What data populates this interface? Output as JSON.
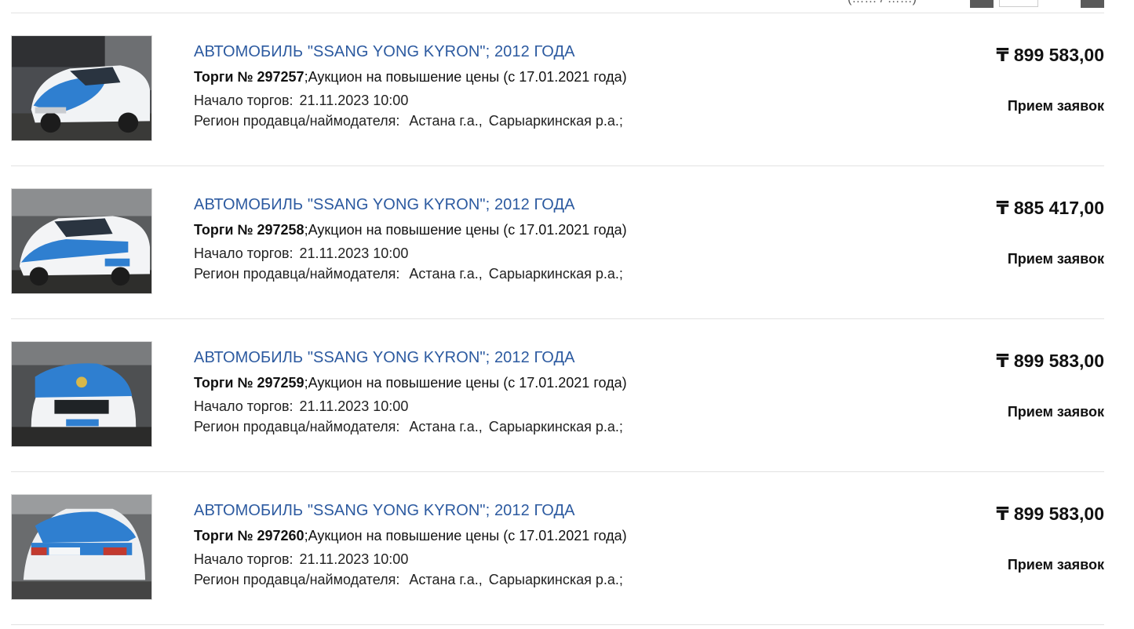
{
  "pagination": {
    "partial_text": "(…… / ……)"
  },
  "labels": {
    "auction_prefix": "Торги №",
    "start_label": "Начало торгов:",
    "region_label": "Регион продавца/наймодателя:"
  },
  "colors": {
    "link": "#2c5aa0",
    "divider": "#e2e2e2",
    "pager_dark": "#5a5a5a"
  },
  "lots": [
    {
      "title": "АВТОМОБИЛЬ \"SSANG YONG KYRON\"; 2012 ГОДА",
      "auction_number": "297257",
      "auction_type": ";Аукцион на повышение цены (с 17.01.2021 года)",
      "start_datetime": "21.11.2023 10:00",
      "region_city": "Астана г.а.,",
      "region_district": "Сарыаркинская р.а.;",
      "price": "₸ 899 583,00",
      "status": "Прием заявок",
      "photo_icon": "car-photo-icon"
    },
    {
      "title": "АВТОМОБИЛЬ \"SSANG YONG KYRON\"; 2012 ГОДА",
      "auction_number": "297258",
      "auction_type": ";Аукцион на повышение цены (с 17.01.2021 года)",
      "start_datetime": "21.11.2023 10:00",
      "region_city": "Астана г.а.,",
      "region_district": "Сарыаркинская р.а.;",
      "price": "₸ 885 417,00",
      "status": "Прием заявок",
      "photo_icon": "car-photo-icon"
    },
    {
      "title": "АВТОМОБИЛЬ \"SSANG YONG KYRON\"; 2012 ГОДА",
      "auction_number": "297259",
      "auction_type": ";Аукцион на повышение цены (с 17.01.2021 года)",
      "start_datetime": "21.11.2023 10:00",
      "region_city": "Астана г.а.,",
      "region_district": "Сарыаркинская р.а.;",
      "price": "₸ 899 583,00",
      "status": "Прием заявок",
      "photo_icon": "car-photo-icon"
    },
    {
      "title": "АВТОМОБИЛЬ \"SSANG YONG KYRON\"; 2012 ГОДА",
      "auction_number": "297260",
      "auction_type": ";Аукцион на повышение цены (с 17.01.2021 года)",
      "start_datetime": "21.11.2023 10:00",
      "region_city": "Астана г.а.,",
      "region_district": "Сарыаркинская р.а.;",
      "price": "₸ 899 583,00",
      "status": "Прием заявок",
      "photo_icon": "car-photo-icon"
    }
  ]
}
